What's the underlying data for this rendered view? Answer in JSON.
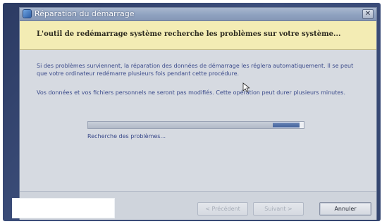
{
  "window": {
    "title": "Réparation du démarrage",
    "close_glyph": "✕"
  },
  "header": {
    "text": "L'outil de redémarrage système recherche les problèmes sur votre système..."
  },
  "content": {
    "paragraph1": "Si des problèmes surviennent, la réparation des données de démarrage les réglera automatiquement. Il se peut que votre ordinateur redémarre plusieurs fois pendant cette procédure.",
    "paragraph2": "Vos données et vos fichiers personnels ne seront pas modifiés. Cette opération peut durer plusieurs minutes.",
    "status": "Recherche des problèmes..."
  },
  "progress": {
    "type": "marquee"
  },
  "buttons": {
    "previous": "< Précédent",
    "next": "Suivant >",
    "cancel": "Annuler"
  },
  "icons": {
    "app": "startup-repair-icon",
    "close": "close-icon",
    "cursor": "mouse-pointer-icon"
  }
}
